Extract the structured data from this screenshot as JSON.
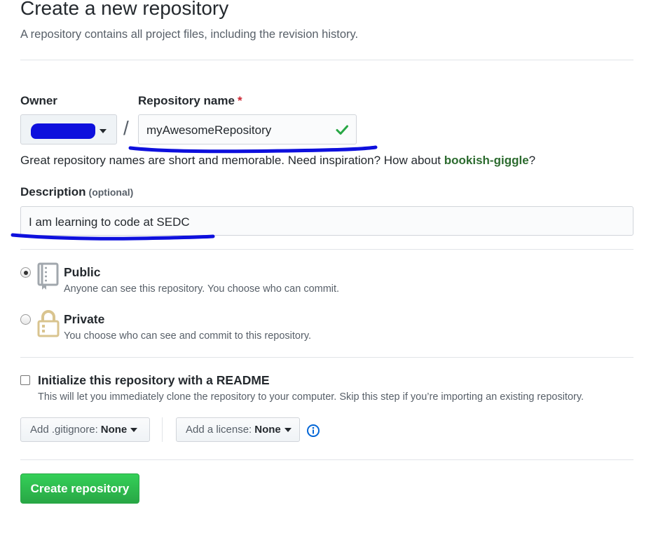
{
  "header": {
    "title": "Create a new repository",
    "subtitle": "A repository contains all project files, including the revision history."
  },
  "owner": {
    "label": "Owner",
    "value_redacted": true
  },
  "separator": "/",
  "repo_name": {
    "label": "Repository name",
    "required_mark": "*",
    "value": "myAwesomeRepository",
    "valid": true
  },
  "hint": {
    "text": "Great repository names are short and memorable. Need inspiration? How about ",
    "suggestion": "bookish-giggle",
    "end": "?"
  },
  "description": {
    "label": "Description",
    "optional": "(optional)",
    "value": "I am learning to code at SEDC"
  },
  "visibility": {
    "public": {
      "title": "Public",
      "desc": "Anyone can see this repository. You choose who can commit.",
      "selected": true
    },
    "private": {
      "title": "Private",
      "desc": "You choose who can see and commit to this repository.",
      "selected": false
    }
  },
  "readme": {
    "label": "Initialize this repository with a README",
    "desc": "This will let you immediately clone the repository to your computer. Skip this step if you’re importing an existing repository.",
    "checked": false
  },
  "gitignore": {
    "label": "Add .gitignore:",
    "value": "None"
  },
  "license": {
    "label": "Add a license:",
    "value": "None"
  },
  "submit": {
    "label": "Create repository"
  },
  "colors": {
    "primary_button": "#2ea44f",
    "check": "#28a745",
    "annotation": "#0e10dd",
    "info_icon": "#0366d6"
  }
}
